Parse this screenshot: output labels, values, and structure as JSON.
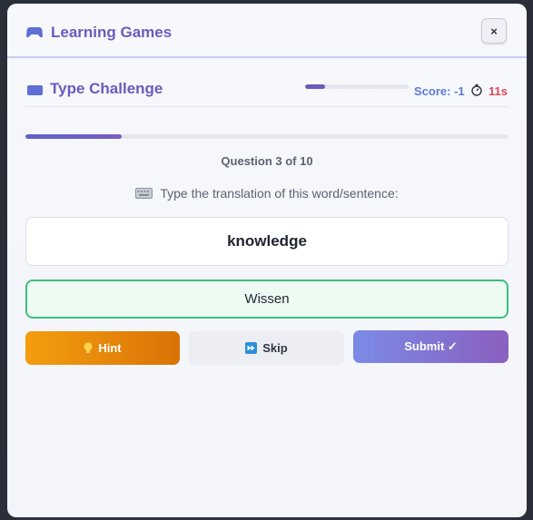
{
  "modal": {
    "title": "Learning Games",
    "close_label": "×"
  },
  "game": {
    "title": "Type Challenge",
    "mini_progress": 0.19,
    "score": "Score: -1",
    "timer": "11s"
  },
  "quiz": {
    "progress": 0.2,
    "counter": "Question 3 of 10",
    "instruction": "Type the translation of this word/sentence:",
    "word": "knowledge",
    "answer_value": "Wissen"
  },
  "buttons": {
    "hint_label": "Hint",
    "skip_label": "Skip",
    "submit_label": "Submit ✓"
  },
  "colors": {
    "accent": "#6a5bbd",
    "hint": "#f49d0f",
    "success_border": "#3bbf7e",
    "timer": "#e0475b"
  },
  "icons": {
    "app": "gamepad-icon",
    "game": "keyboard-card-icon",
    "timer": "stopwatch-icon",
    "instruction": "keyboard-icon",
    "hint": "lightbulb-icon",
    "skip": "fast-forward-icon"
  }
}
